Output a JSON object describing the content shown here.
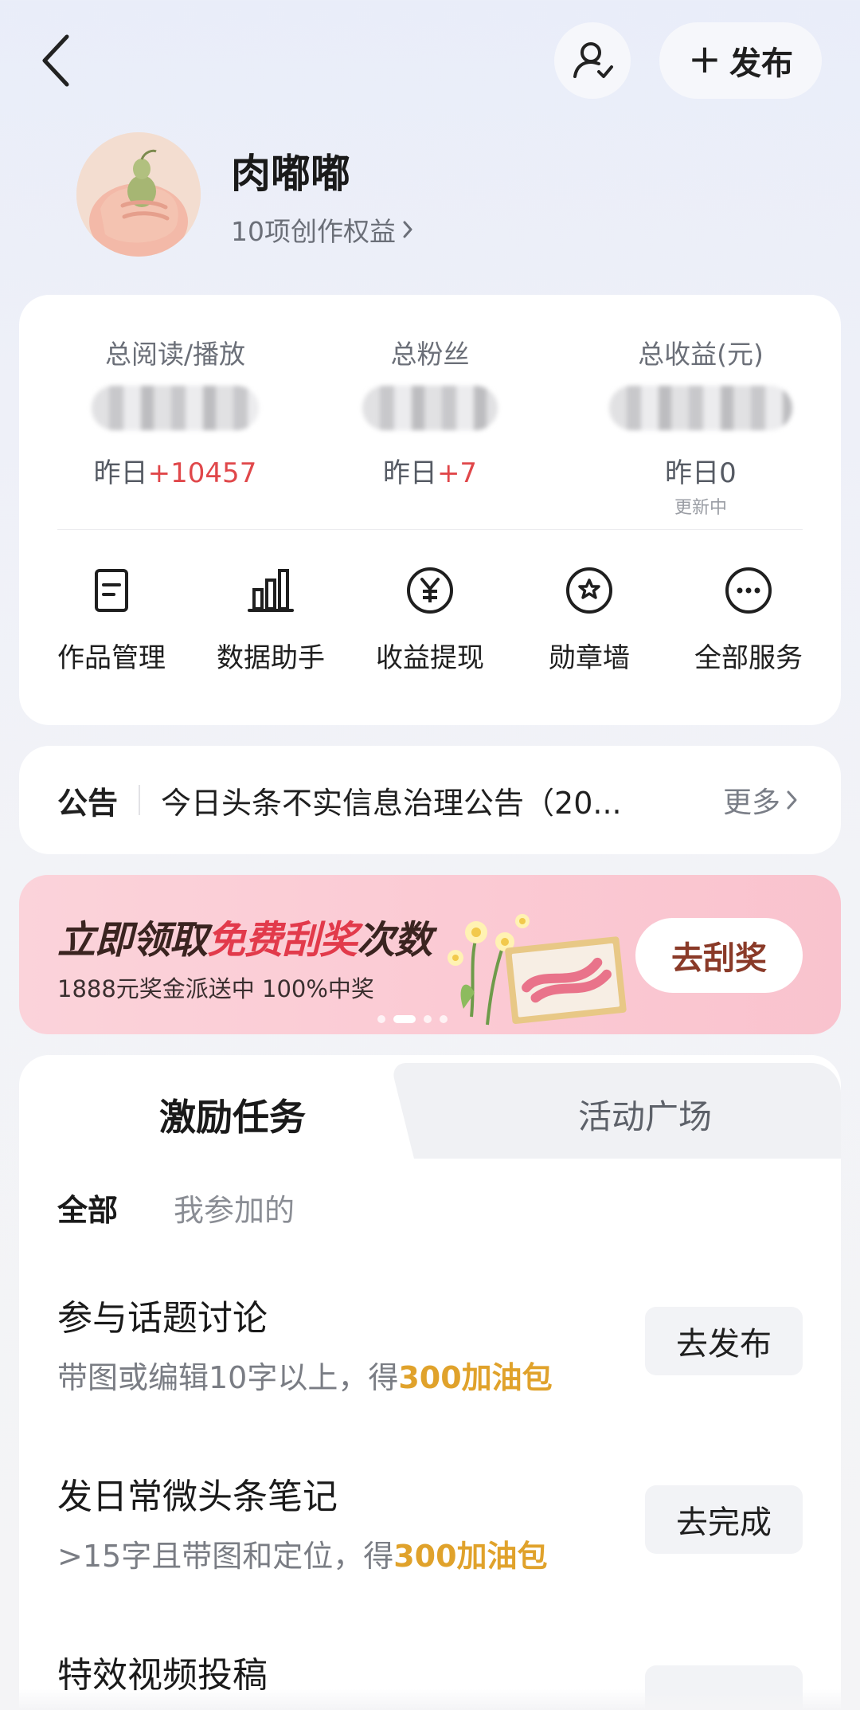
{
  "header": {
    "publish_label": "发布"
  },
  "profile": {
    "username": "肉嘟嘟",
    "benefits_label": "10项创作权益"
  },
  "stats": [
    {
      "label": "总阅读/播放",
      "yesterday_prefix": "昨日",
      "yesterday_value": "+10457",
      "note": ""
    },
    {
      "label": "总粉丝",
      "yesterday_prefix": "昨日",
      "yesterday_value": "+7",
      "note": ""
    },
    {
      "label": "总收益(元)",
      "yesterday_prefix": "昨日",
      "yesterday_value": "0",
      "note": "更新中"
    }
  ],
  "services": [
    {
      "label": "作品管理",
      "icon": "document-icon"
    },
    {
      "label": "数据助手",
      "icon": "bar-chart-icon"
    },
    {
      "label": "收益提现",
      "icon": "yuan-icon"
    },
    {
      "label": "勋章墙",
      "icon": "star-badge-icon"
    },
    {
      "label": "全部服务",
      "icon": "more-icon"
    }
  ],
  "notice": {
    "tag": "公告",
    "text": "今日头条不实信息治理公告（20...",
    "more": "更多"
  },
  "banner": {
    "title_pre": "立即领取",
    "title_highlight": "免费刮奖",
    "title_post": "次数",
    "subtitle": "1888元奖金派送中 100%中奖",
    "button": "去刮奖",
    "highlight_color": "#e23a4b"
  },
  "tabs": {
    "active": "激励任务",
    "inactive": "活动广场"
  },
  "filters": {
    "all": "全部",
    "mine": "我参加的"
  },
  "tasks": [
    {
      "title": "参与话题讨论",
      "desc_pre": "带图或编辑10字以上，得",
      "reward": "300加油包",
      "button": "去发布"
    },
    {
      "title": "发日常微头条笔记",
      "desc_pre": ">15字且带图和定位，得",
      "reward": "300加油包",
      "button": "去完成"
    },
    {
      "title": "特效视频投稿",
      "desc_pre": "",
      "reward": "",
      "button": ""
    }
  ],
  "colors": {
    "increase": "#e0474a",
    "reward": "#e0a22b",
    "banner_bg": "#fbd3da"
  }
}
